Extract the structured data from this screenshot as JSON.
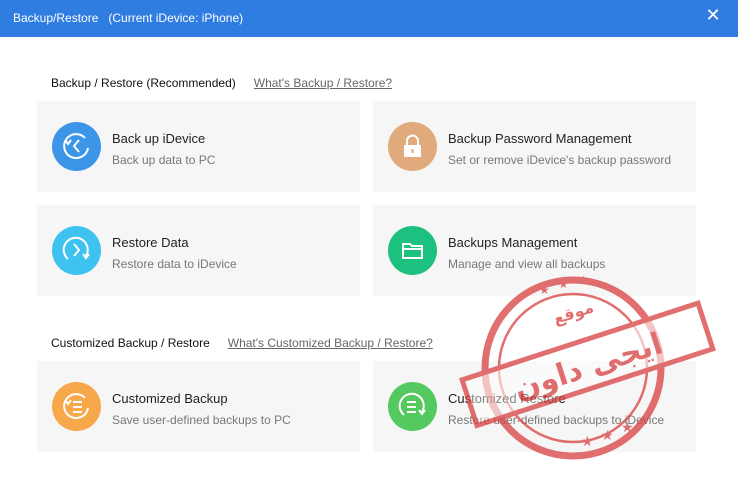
{
  "window": {
    "title": "Backup/Restore",
    "device": "(Current iDevice: iPhone)",
    "close_glyph": "✕",
    "colors": {
      "titlebar": "#2f7de1"
    }
  },
  "sections": [
    {
      "title": "Backup / Restore (Recommended)",
      "link": "What's Backup / Restore?",
      "cards": [
        {
          "title": "Back up iDevice",
          "subtitle": "Back up data to PC",
          "icon": "backup-circle-icon",
          "color": "#3d95e8"
        },
        {
          "title": "Backup Password Management",
          "subtitle": "Set or remove iDevice's backup password",
          "icon": "lock-icon",
          "color": "#e0aa7c"
        },
        {
          "title": "Restore Data",
          "subtitle": "Restore data to iDevice",
          "icon": "restore-circle-icon",
          "color": "#3ec3f0"
        },
        {
          "title": "Backups Management",
          "subtitle": "Manage and view all backups",
          "icon": "folder-icon",
          "color": "#1cc17f"
        }
      ]
    },
    {
      "title": "Customized Backup / Restore",
      "link": "What's Customized Backup / Restore?",
      "cards": [
        {
          "title": "Customized Backup",
          "subtitle": "Save user-defined backups to PC",
          "icon": "custom-backup-icon",
          "color": "#f7a84a"
        },
        {
          "title": "Customized Restore",
          "subtitle": "Restore user-defined backups to iDevice",
          "icon": "custom-restore-icon",
          "color": "#53c960"
        }
      ]
    }
  ],
  "watermark": {
    "top_text": "موقع",
    "main_text": "ايجى داون",
    "color": "#d94040"
  }
}
